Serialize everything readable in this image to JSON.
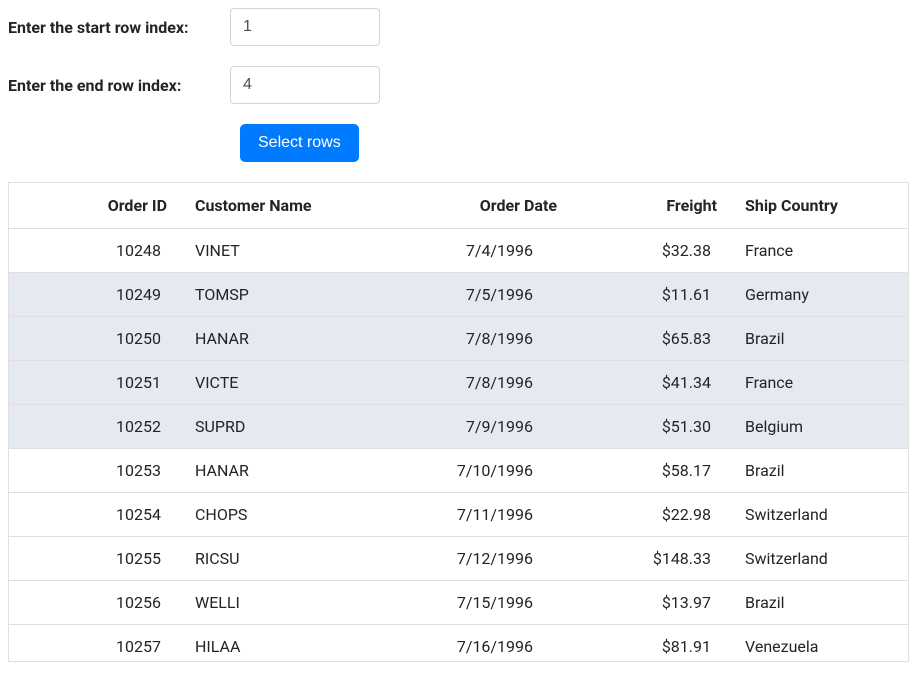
{
  "form": {
    "start_label": "Enter the start row index:",
    "end_label": "Enter the end row index:",
    "start_value": "1",
    "end_value": "4",
    "button_label": "Select rows"
  },
  "columns": {
    "orderid": "Order ID",
    "customer": "Customer Name",
    "date": "Order Date",
    "freight": "Freight",
    "country": "Ship Country"
  },
  "rows": [
    {
      "orderid": "10248",
      "customer": "VINET",
      "date": "7/4/1996",
      "freight": "$32.38",
      "country": "France",
      "selected": false
    },
    {
      "orderid": "10249",
      "customer": "TOMSP",
      "date": "7/5/1996",
      "freight": "$11.61",
      "country": "Germany",
      "selected": true
    },
    {
      "orderid": "10250",
      "customer": "HANAR",
      "date": "7/8/1996",
      "freight": "$65.83",
      "country": "Brazil",
      "selected": true
    },
    {
      "orderid": "10251",
      "customer": "VICTE",
      "date": "7/8/1996",
      "freight": "$41.34",
      "country": "France",
      "selected": true
    },
    {
      "orderid": "10252",
      "customer": "SUPRD",
      "date": "7/9/1996",
      "freight": "$51.30",
      "country": "Belgium",
      "selected": true
    },
    {
      "orderid": "10253",
      "customer": "HANAR",
      "date": "7/10/1996",
      "freight": "$58.17",
      "country": "Brazil",
      "selected": false
    },
    {
      "orderid": "10254",
      "customer": "CHOPS",
      "date": "7/11/1996",
      "freight": "$22.98",
      "country": "Switzerland",
      "selected": false
    },
    {
      "orderid": "10255",
      "customer": "RICSU",
      "date": "7/12/1996",
      "freight": "$148.33",
      "country": "Switzerland",
      "selected": false
    },
    {
      "orderid": "10256",
      "customer": "WELLI",
      "date": "7/15/1996",
      "freight": "$13.97",
      "country": "Brazil",
      "selected": false
    },
    {
      "orderid": "10257",
      "customer": "HILAA",
      "date": "7/16/1996",
      "freight": "$81.91",
      "country": "Venezuela",
      "selected": false
    }
  ]
}
